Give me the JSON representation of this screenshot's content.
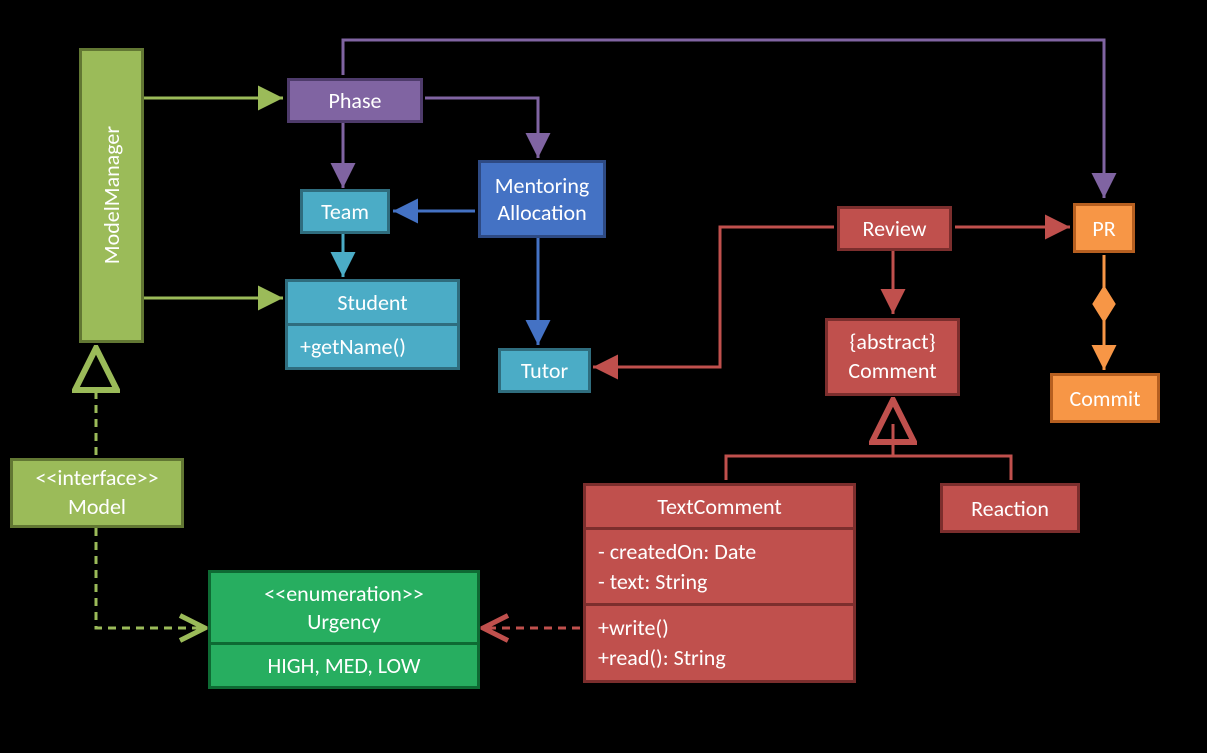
{
  "nodes": {
    "modelManager": "ModelManager",
    "phase": "Phase",
    "team": "Team",
    "student": {
      "name": "Student",
      "method": "+getName()"
    },
    "mentoring": "Mentoring\nAllocation",
    "tutor": "Tutor",
    "review": "Review",
    "comment": "{abstract}\nComment",
    "textComment": {
      "name": "TextComment",
      "attrs": "- createdOn: Date\n- text: String",
      "methods": "+write()\n+read(): String"
    },
    "reaction": "Reaction",
    "pr": "PR",
    "commit": "Commit",
    "model": "<<interface>>\nModel",
    "urgency": {
      "stereo": "<<enumeration>>",
      "name": "Urgency",
      "values": "HIGH, MED, LOW"
    }
  }
}
